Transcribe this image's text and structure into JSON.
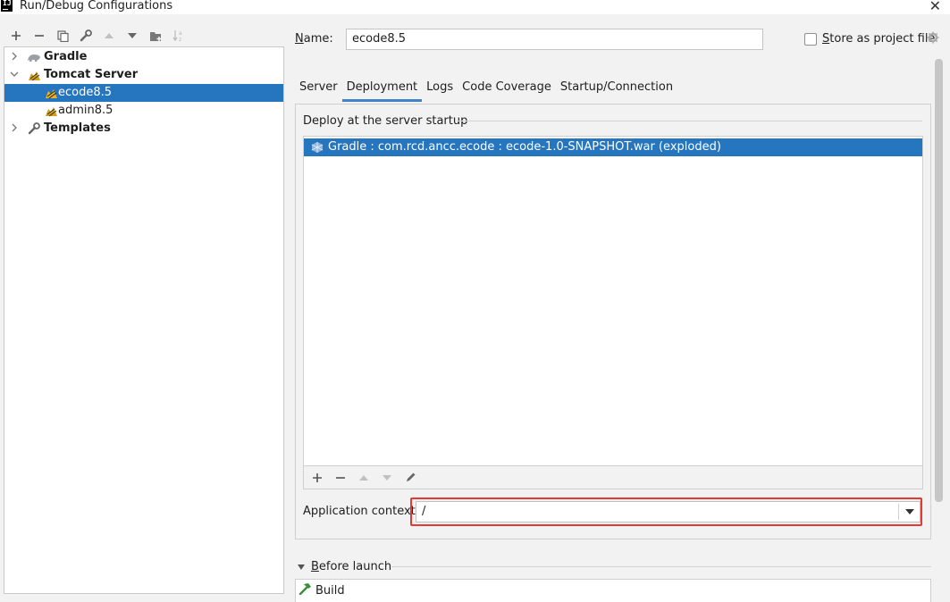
{
  "window": {
    "title": "Run/Debug Configurations",
    "close_glyph": "✕",
    "logo_text": "IJ"
  },
  "toolbar": {
    "icons": [
      "add-icon",
      "remove-icon",
      "copy-icon",
      "wrench-icon",
      "move-up-icon",
      "move-down-icon",
      "folder-add-icon",
      "sort-icon"
    ]
  },
  "tree": {
    "items": [
      {
        "label": "Gradle",
        "icon": "gradle-icon",
        "expanded": false
      },
      {
        "label": "Tomcat Server",
        "icon": "tomcat-icon",
        "expanded": true
      },
      {
        "label": "ecode8.5",
        "icon": "tomcat-icon",
        "selected": true
      },
      {
        "label": "admin8.5",
        "icon": "tomcat-icon"
      },
      {
        "label": "Templates",
        "icon": "wrench-icon",
        "expanded": false
      }
    ]
  },
  "name_field": {
    "label_prefix": "N",
    "label_rest": "ame:",
    "value": "ecode8.5"
  },
  "store_project": {
    "label_prefix": "S",
    "label_rest": "tore as project file",
    "checked": false
  },
  "tabs": [
    {
      "label": "Server",
      "active": false
    },
    {
      "label": "Deployment",
      "active": true
    },
    {
      "label": "Logs",
      "active": false
    },
    {
      "label": "Code Coverage",
      "active": false
    },
    {
      "label": "Startup/Connection",
      "active": false
    }
  ],
  "deployment": {
    "section_title": "Deploy at the server startup",
    "items": [
      {
        "label": "Gradle : com.rcd.ancc.ecode : ecode-1.0-SNAPSHOT.war (exploded)",
        "icon": "artifact-icon",
        "selected": true
      }
    ]
  },
  "app_context": {
    "label": "Application context:",
    "value": "/"
  },
  "before_launch": {
    "label_prefix": "B",
    "label_rest": "efore launch",
    "items": [
      {
        "label": "Build",
        "icon": "hammer-icon"
      }
    ]
  },
  "colors": {
    "selection": "#2675bf",
    "highlight": "#e53935",
    "tab_underline": "#4083c9"
  }
}
